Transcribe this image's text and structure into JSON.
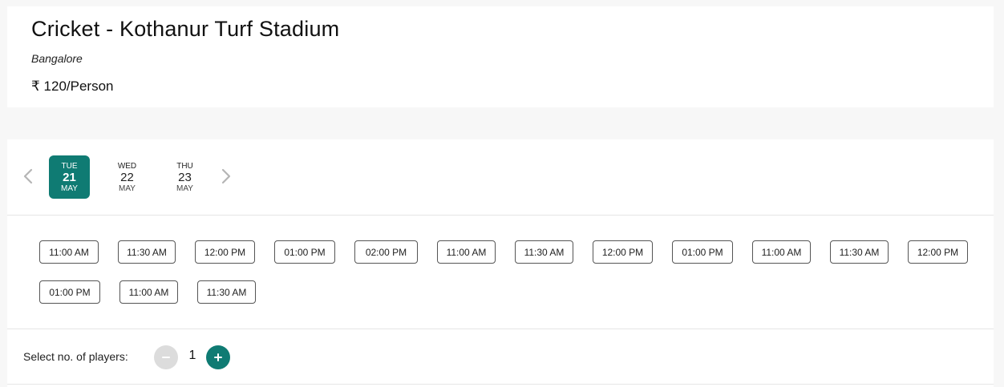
{
  "venue": {
    "title": "Cricket - Kothanur Turf Stadium",
    "city": "Bangalore",
    "price": "₹ 120/Person"
  },
  "dates": [
    {
      "dow": "TUE",
      "day": "21",
      "month": "MAY",
      "selected": true
    },
    {
      "dow": "WED",
      "day": "22",
      "month": "MAY",
      "selected": false
    },
    {
      "dow": "THU",
      "day": "23",
      "month": "MAY",
      "selected": false
    }
  ],
  "slots": [
    "11:00 AM",
    "11:30 AM",
    "12:00 PM",
    "01:00 PM",
    "02:00 PM",
    "11:00 AM",
    "11:30 AM",
    "12:00 PM",
    "01:00 PM",
    "11:00 AM",
    "11:30 AM",
    "12:00 PM",
    "01:00 PM",
    "11:00 AM",
    "11:30 AM"
  ],
  "players": {
    "label": "Select no. of players:",
    "count": "1"
  },
  "colors": {
    "accent": "#0f7b73",
    "minus_bg": "#dcdcdc"
  }
}
